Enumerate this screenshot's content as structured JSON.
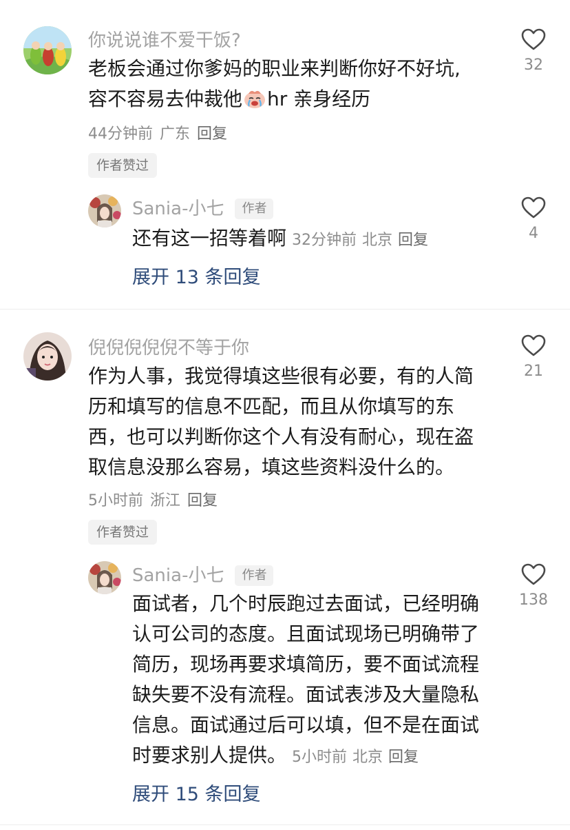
{
  "comments": [
    {
      "username": "你说说谁不爱干饭?",
      "line1": "老板会通过你爹妈的职业来判断你好不好坑,",
      "line2_before": "容不容易去仲裁他",
      "line2_after": "hr 亲身经历",
      "time": "44分钟前",
      "location": "广东",
      "reply": "回复",
      "badge": "作者赞过",
      "likes": "32",
      "replies": [
        {
          "username": "Sania-小七",
          "tag": "作者",
          "text": "还有这一招等着啊",
          "time": "32分钟前",
          "location": "北京",
          "reply": "回复",
          "likes": "4"
        }
      ],
      "expand": "展开 13 条回复"
    },
    {
      "username": "倪倪倪倪倪不等于你",
      "lines": [
        "作为人事，我觉得填这些很有必要，有的人简",
        "历和填写的信息不匹配，而且从你填写的东",
        "西，也可以判断你这个人有没有耐心，现在盗",
        "取信息没那么容易，填这些资料没什么的。"
      ],
      "time": "5小时前",
      "location": "浙江",
      "reply": "回复",
      "badge": "作者赞过",
      "likes": "21",
      "replies": [
        {
          "username": "Sania-小七",
          "tag": "作者",
          "lines": [
            "面试者，几个时辰跑过去面试，已经明确",
            "认可公司的态度。且面试现场已明确带了",
            "简历，现场再要求填简历，要不面试流程",
            "缺失要不没有流程。面试表涉及大量隐私",
            "信息。面试通过后可以填，但不是在面试",
            "时要求别人提供。"
          ],
          "time": "5小时前",
          "location": "北京",
          "reply": "回复",
          "likes": "138"
        }
      ],
      "expand": "展开 15 条回复"
    }
  ],
  "icons": {
    "like": "heart-outline-icon",
    "emoji": "crying-face-emoji"
  },
  "colors": {
    "link": "#2f4c7a",
    "muted": "#8c8c8c",
    "text": "#1c1c1c"
  }
}
